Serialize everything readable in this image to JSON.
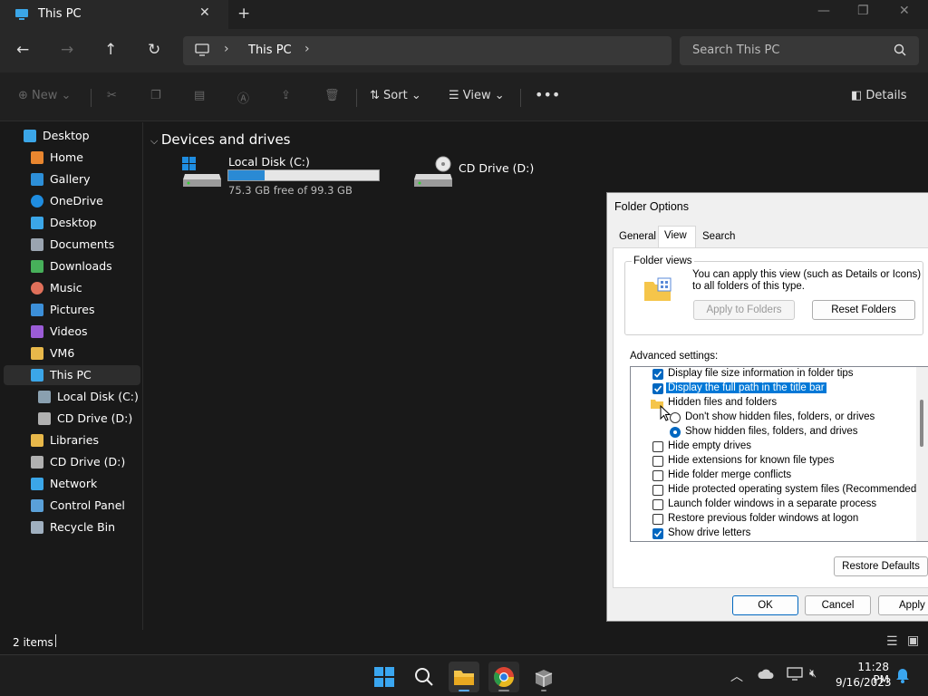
{
  "window": {
    "tab_title": "This PC"
  },
  "address": {
    "crumb": "This PC"
  },
  "search": {
    "placeholder": "Search This PC"
  },
  "commands": {
    "new": "New",
    "sort": "Sort",
    "view": "View",
    "details": "Details"
  },
  "sidebar": {
    "items": [
      {
        "label": "Desktop",
        "color": "#3ba6e8"
      },
      {
        "label": "Home",
        "color": "#e9862f"
      },
      {
        "label": "Gallery",
        "color": "#2d8fd8"
      },
      {
        "label": "OneDrive",
        "color": "#1f8de0"
      },
      {
        "label": "Desktop",
        "color": "#3ba6e8"
      },
      {
        "label": "Documents",
        "color": "#9aa4b0"
      },
      {
        "label": "Downloads",
        "color": "#47b05a"
      },
      {
        "label": "Music",
        "color": "#e0705a"
      },
      {
        "label": "Pictures",
        "color": "#3c8fd8"
      },
      {
        "label": "Videos",
        "color": "#9b5cd6"
      },
      {
        "label": "VM6",
        "color": "#e8b84a"
      },
      {
        "label": "This PC",
        "color": "#3ba6e8"
      },
      {
        "label": "Local Disk (C:)",
        "color": "#8aa0b0"
      },
      {
        "label": "CD Drive (D:)",
        "color": "#b0b0b0"
      },
      {
        "label": "Libraries",
        "color": "#e8b84a"
      },
      {
        "label": "CD Drive (D:)",
        "color": "#b0b0b0"
      },
      {
        "label": "Network",
        "color": "#3ba6e8"
      },
      {
        "label": "Control Panel",
        "color": "#5aa0d8"
      },
      {
        "label": "Recycle Bin",
        "color": "#a0b0c0"
      }
    ]
  },
  "main": {
    "group_title": "Devices and drives",
    "drives": [
      {
        "name": "Local Disk (C:)",
        "free": "75.3 GB free of 99.3 GB",
        "used_fraction": 0.242
      },
      {
        "name": "CD Drive (D:)"
      }
    ]
  },
  "status": {
    "items": "2 items"
  },
  "dialog": {
    "title": "Folder Options",
    "tabs": [
      "General",
      "View",
      "Search"
    ],
    "folder_views": {
      "legend": "Folder views",
      "text": "You can apply this view (such as Details or Icons) to all folders of this type.",
      "apply": "Apply to Folders",
      "reset": "Reset Folders"
    },
    "advanced_label": "Advanced settings:",
    "settings": [
      {
        "label": "Display file size information in folder tips",
        "kind": "check",
        "checked": true
      },
      {
        "label": "Display the full path in the title bar",
        "kind": "check",
        "checked": true,
        "selected": true
      },
      {
        "label": "Hidden files and folders",
        "kind": "folder"
      },
      {
        "label": "Don't show hidden files, folders, or drives",
        "kind": "radio",
        "checked": false
      },
      {
        "label": "Show hidden files, folders, and drives",
        "kind": "radio",
        "checked": true
      },
      {
        "label": "Hide empty drives",
        "kind": "check",
        "checked": false
      },
      {
        "label": "Hide extensions for known file types",
        "kind": "check",
        "checked": false
      },
      {
        "label": "Hide folder merge conflicts",
        "kind": "check",
        "checked": false
      },
      {
        "label": "Hide protected operating system files (Recommended)",
        "kind": "check",
        "checked": false
      },
      {
        "label": "Launch folder windows in a separate process",
        "kind": "check",
        "checked": false
      },
      {
        "label": "Restore previous folder windows at logon",
        "kind": "check",
        "checked": false
      },
      {
        "label": "Show drive letters",
        "kind": "check",
        "checked": true
      }
    ],
    "restore_defaults": "Restore Defaults",
    "ok": "OK",
    "cancel": "Cancel",
    "apply": "Apply"
  },
  "clock": {
    "time": "11:28 PM",
    "date": "9/16/2023"
  }
}
